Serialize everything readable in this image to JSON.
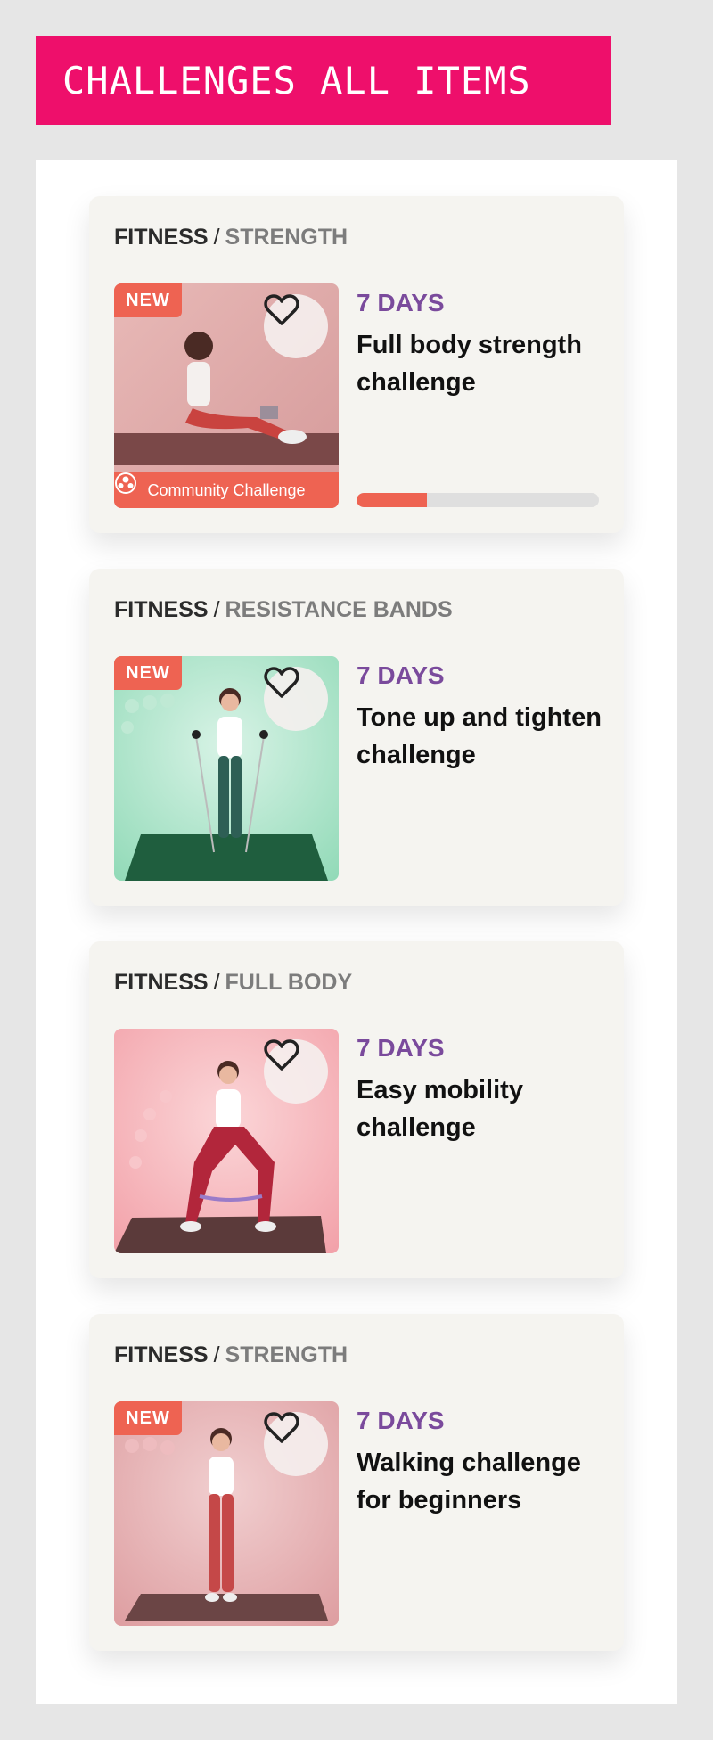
{
  "header": {
    "title": "CHALLENGES ALL ITEMS"
  },
  "colors": {
    "header_bg": "#ee0f6b",
    "badge": "#ee6352",
    "days": "#7a4a9c",
    "progress": "#ee6352"
  },
  "cards": [
    {
      "category": "FITNESS",
      "subcategory": "STRENGTH",
      "badge": "NEW",
      "duration": "7 DAYS",
      "title": "Full body strength challenge",
      "community_label": "Community Challenge",
      "community_icon": "community-icon",
      "favorite_icon": "heart-icon",
      "progress": 0.29
    },
    {
      "category": "FITNESS",
      "subcategory": "RESISTANCE BANDS",
      "badge": "NEW",
      "duration": "7 DAYS",
      "title": "Tone up and tighten challenge",
      "favorite_icon": "heart-icon"
    },
    {
      "category": "FITNESS",
      "subcategory": "FULL BODY",
      "duration": "7 DAYS",
      "title": "Easy mobility challenge",
      "favorite_icon": "heart-icon"
    },
    {
      "category": "FITNESS",
      "subcategory": "STRENGTH",
      "badge": "NEW",
      "duration": "7 DAYS",
      "title": "Walking challenge for beginners",
      "favorite_icon": "heart-icon"
    }
  ]
}
